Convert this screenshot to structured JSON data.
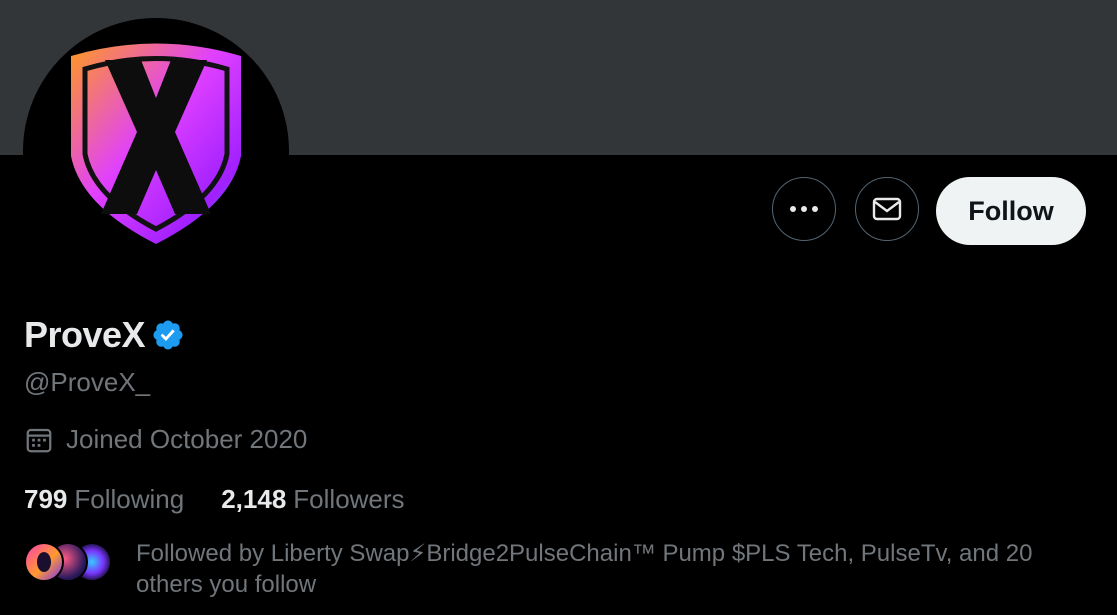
{
  "profile": {
    "display_name": "ProveX",
    "handle": "@ProveX_",
    "joined": "Joined October 2020",
    "verified": true
  },
  "stats": {
    "following_count": "799",
    "following_label": "Following",
    "followers_count": "2,148",
    "followers_label": "Followers"
  },
  "actions": {
    "follow_label": "Follow",
    "more_icon": "more-icon",
    "message_icon": "envelope-icon"
  },
  "followed_by": {
    "text": "Followed by Liberty Swap⚡Bridge2PulseChain™ Pump $PLS Tech, PulseTv, and 20 others you follow"
  },
  "colors": {
    "banner": "#333639",
    "background": "#000000",
    "primary_text": "#e7e9ea",
    "secondary_text": "#71767b",
    "verified_blue": "#1d9bf0",
    "follow_button_bg": "#eff3f4"
  }
}
